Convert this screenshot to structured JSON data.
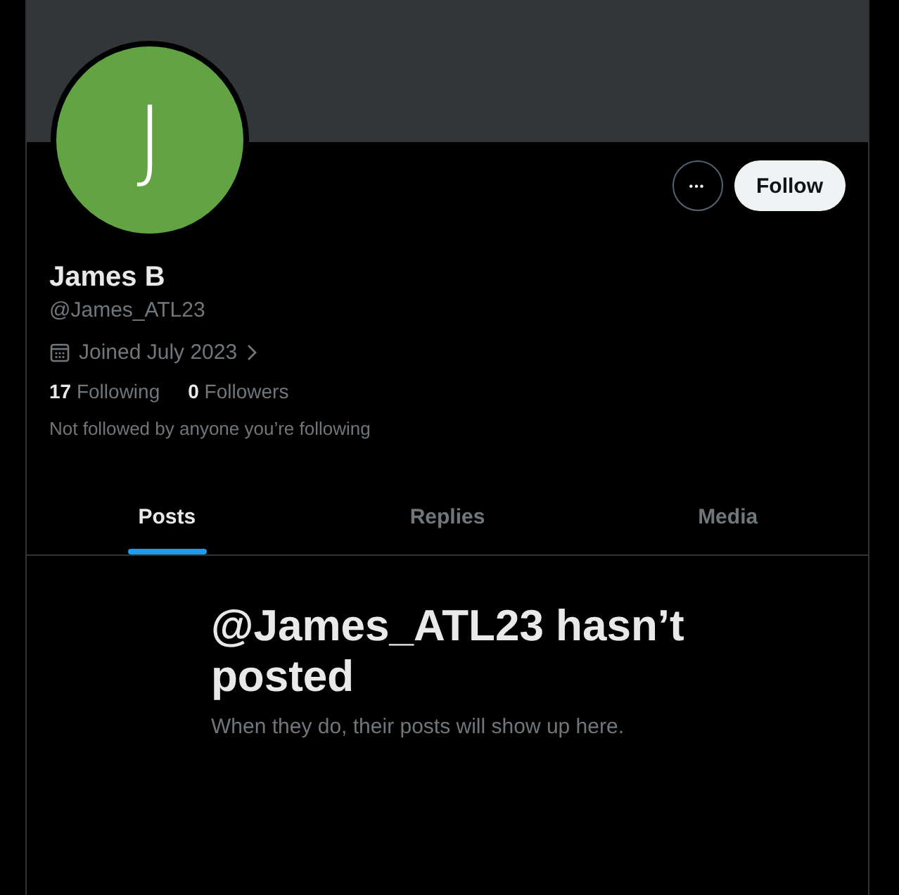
{
  "profile": {
    "avatar_letter": "J",
    "name": "James B",
    "handle": "@James_ATL23",
    "joined": "Joined July 2023",
    "note": "Not followed by anyone you’re following"
  },
  "actions": {
    "more": "•••",
    "follow": "Follow"
  },
  "stats": [
    {
      "count": "17",
      "label": "Following"
    },
    {
      "count": "0",
      "label": "Followers"
    }
  ],
  "tabs": [
    {
      "label": "Posts",
      "selected": true
    },
    {
      "label": "Replies",
      "selected": false
    },
    {
      "label": "Media",
      "selected": false
    }
  ],
  "empty_state": {
    "title": "@James_ATL23 hasn’t posted",
    "subtitle": "When they do, their posts will show up here."
  }
}
